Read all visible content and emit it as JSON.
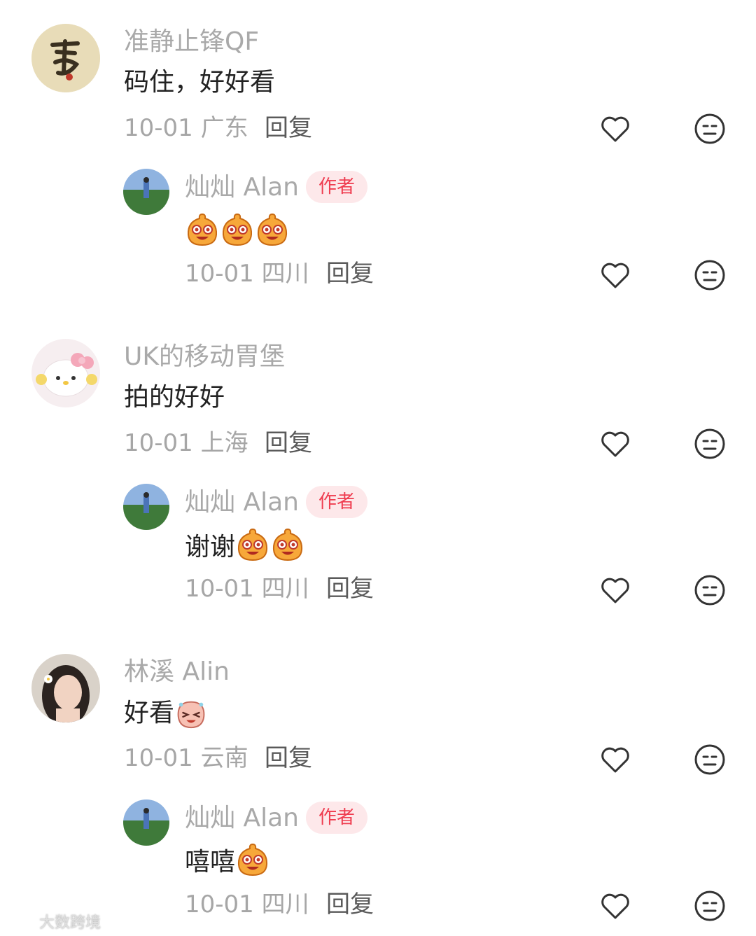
{
  "comments": [
    {
      "user": "准静止锋QF",
      "text": "码住，好好看",
      "date": "10-01",
      "location": "广东",
      "reply_label": "回复",
      "reply": {
        "user": "灿灿 Alan",
        "badge": "作者",
        "text": "",
        "emoji_count": 3,
        "date": "10-01",
        "location": "四川",
        "reply_label": "回复"
      }
    },
    {
      "user": "UK的移动胃堡",
      "text": "拍的好好",
      "date": "10-01",
      "location": "上海",
      "reply_label": "回复",
      "reply": {
        "user": "灿灿 Alan",
        "badge": "作者",
        "text": "谢谢",
        "emoji_count": 2,
        "date": "10-01",
        "location": "四川",
        "reply_label": "回复"
      }
    },
    {
      "user": "林溪 Alin",
      "text": "好看",
      "date": "10-01",
      "location": "云南",
      "reply_label": "回复",
      "reply": {
        "user": "灿灿 Alan",
        "badge": "作者",
        "text": "嘻嘻",
        "emoji_count": 1,
        "date": "10-01",
        "location": "四川",
        "reply_label": "回复"
      }
    }
  ],
  "watermark": "大数跨境",
  "icons": {
    "like": "heart-icon",
    "dislike": "neutral-face-icon"
  },
  "colors": {
    "badge_bg": "#fde8ea",
    "badge_text": "#ef3d50"
  }
}
